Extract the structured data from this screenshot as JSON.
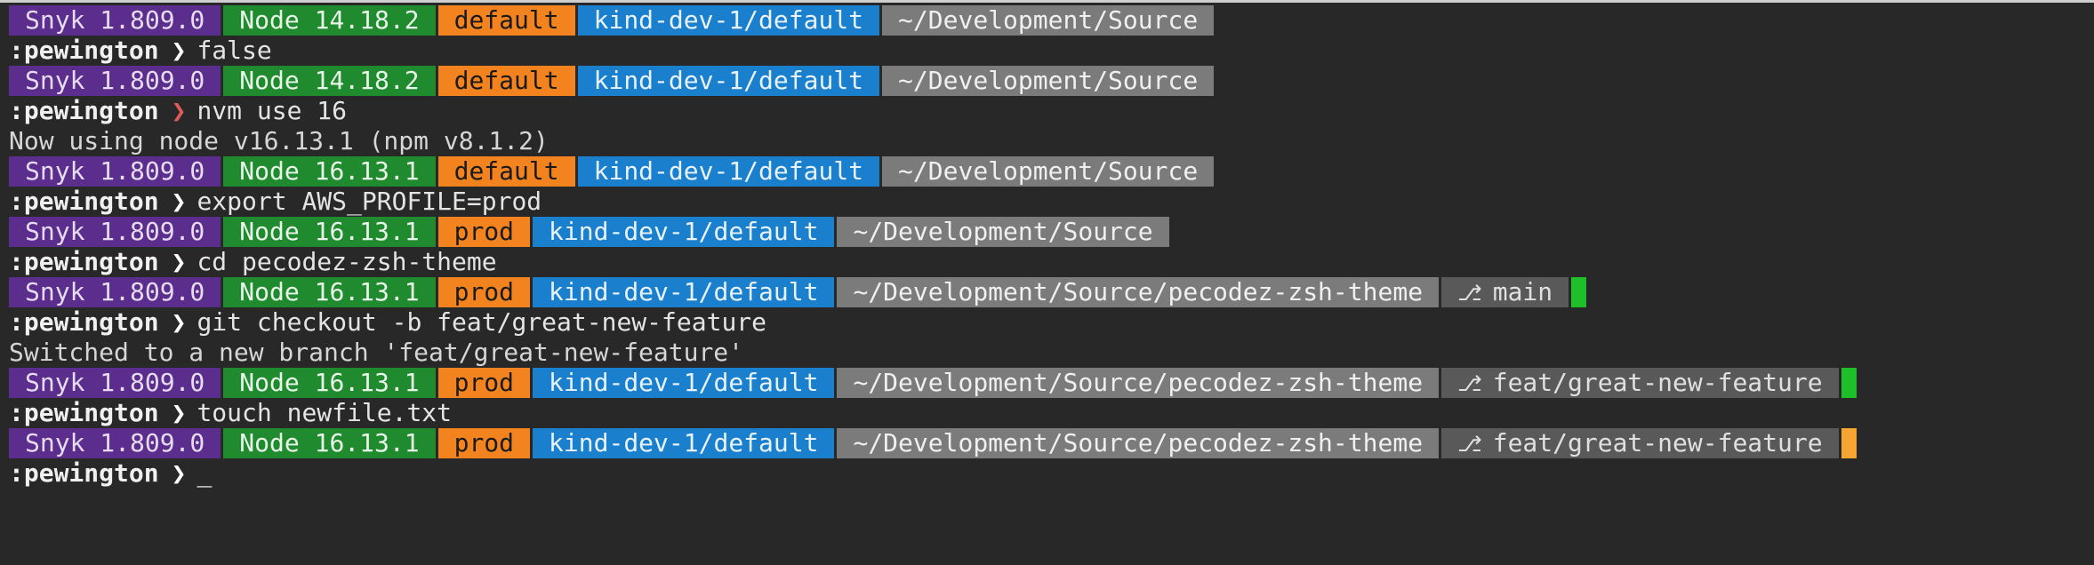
{
  "colors": {
    "snyk": "#5b2d8c",
    "node": "#1f8a2e",
    "aws": "#f2831f",
    "kube": "#1a7fcc",
    "dir": "#7b7b7b",
    "git": "#595959",
    "git_clean": "#1fbf2a",
    "git_dirty": "#f7a531",
    "arrow_ok": "#ffffff",
    "arrow_err": "#e05a5a"
  },
  "prompt": {
    "user": ":pewington",
    "arrow": "❯",
    "cursor": "_"
  },
  "lines": [
    {
      "kind": "status",
      "snyk": "Snyk 1.809.0",
      "node": "Node 14.18.2",
      "aws": "default",
      "kube": "kind-dev-1/default",
      "dir": "~/Development/Source"
    },
    {
      "kind": "command",
      "arrow_color": "#ffffff",
      "text": "false"
    },
    {
      "kind": "status",
      "snyk": "Snyk 1.809.0",
      "node": "Node 14.18.2",
      "aws": "default",
      "kube": "kind-dev-1/default",
      "dir": "~/Development/Source"
    },
    {
      "kind": "command",
      "arrow_color": "#e05a5a",
      "text": "nvm use 16"
    },
    {
      "kind": "output",
      "text": "Now using node v16.13.1 (npm v8.1.2)"
    },
    {
      "kind": "status",
      "snyk": "Snyk 1.809.0",
      "node": "Node 16.13.1",
      "aws": "default",
      "kube": "kind-dev-1/default",
      "dir": "~/Development/Source"
    },
    {
      "kind": "command",
      "arrow_color": "#ffffff",
      "text": "export AWS_PROFILE=prod"
    },
    {
      "kind": "status",
      "snyk": "Snyk 1.809.0",
      "node": "Node 16.13.1",
      "aws": "prod",
      "kube": "kind-dev-1/default",
      "dir": "~/Development/Source"
    },
    {
      "kind": "command",
      "arrow_color": "#ffffff",
      "text": "cd pecodez-zsh-theme"
    },
    {
      "kind": "status",
      "snyk": "Snyk 1.809.0",
      "node": "Node 16.13.1",
      "aws": "prod",
      "kube": "kind-dev-1/default",
      "dir": "~/Development/Source/pecodez-zsh-theme",
      "git_icon": "git-branch-icon",
      "git": "main",
      "git_state_color": "#1fbf2a"
    },
    {
      "kind": "command",
      "arrow_color": "#ffffff",
      "text": "git checkout -b feat/great-new-feature"
    },
    {
      "kind": "output",
      "text": "Switched to a new branch 'feat/great-new-feature'"
    },
    {
      "kind": "status",
      "snyk": "Snyk 1.809.0",
      "node": "Node 16.13.1",
      "aws": "prod",
      "kube": "kind-dev-1/default",
      "dir": "~/Development/Source/pecodez-zsh-theme",
      "git_icon": "git-branch-icon",
      "git": "feat/great-new-feature",
      "git_state_color": "#1fbf2a"
    },
    {
      "kind": "command",
      "arrow_color": "#ffffff",
      "text": "touch newfile.txt"
    },
    {
      "kind": "status",
      "snyk": "Snyk 1.809.0",
      "node": "Node 16.13.1",
      "aws": "prod",
      "kube": "kind-dev-1/default",
      "dir": "~/Development/Source/pecodez-zsh-theme",
      "git_icon": "git-branch-icon",
      "git": "feat/great-new-feature",
      "git_state_color": "#f7a531"
    },
    {
      "kind": "prompt",
      "arrow_color": "#ffffff"
    }
  ]
}
